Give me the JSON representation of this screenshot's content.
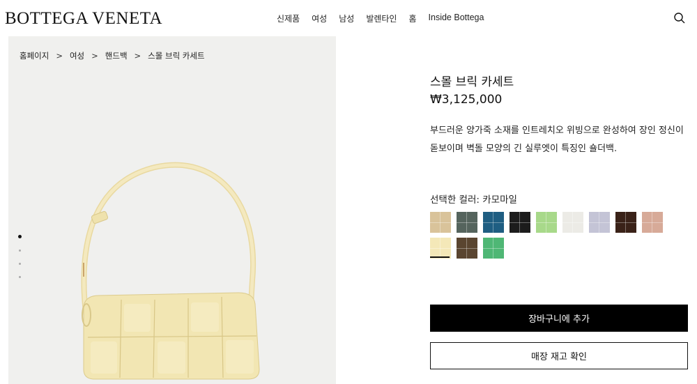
{
  "header": {
    "logo": "BOTTEGA VENETA",
    "nav": [
      "신제품",
      "여성",
      "남성",
      "발렌타인",
      "홈",
      "Inside Bottega"
    ],
    "search_icon": "search-icon"
  },
  "breadcrumb": [
    "홈페이지",
    "여성",
    "핸드백",
    "스몰 브릭 카세트"
  ],
  "breadcrumb_sep": ">",
  "carousel": {
    "count": 4,
    "active": 1
  },
  "product": {
    "title": "스몰 브릭 카세트",
    "price": "₩3,125,000",
    "description": "부드러운 양가죽 소재를 인트레치오 위빙으로 완성하여 장인 정신이 돋보이며 벽돌 모양의 긴 실루엣이 특징인 숄더백.",
    "color_label": "선택한 컬러: 카모마일",
    "swatches": [
      "#d9c39a",
      "#55645d",
      "#1f5e82",
      "#1c1c1c",
      "#a8d98a",
      "#ecebe6",
      "#c4c4d6",
      "#3a2218",
      "#d7aa98",
      "#f4e8b8",
      "#5a4530",
      "#4fb775"
    ],
    "selected_swatch": 9
  },
  "buttons": {
    "add_to_cart": "장바구니에 추가",
    "check_stock": "매장 재고 확인"
  },
  "colors": {
    "bag": "#f2e6b3",
    "panel_bg": "#f0f0ee"
  }
}
